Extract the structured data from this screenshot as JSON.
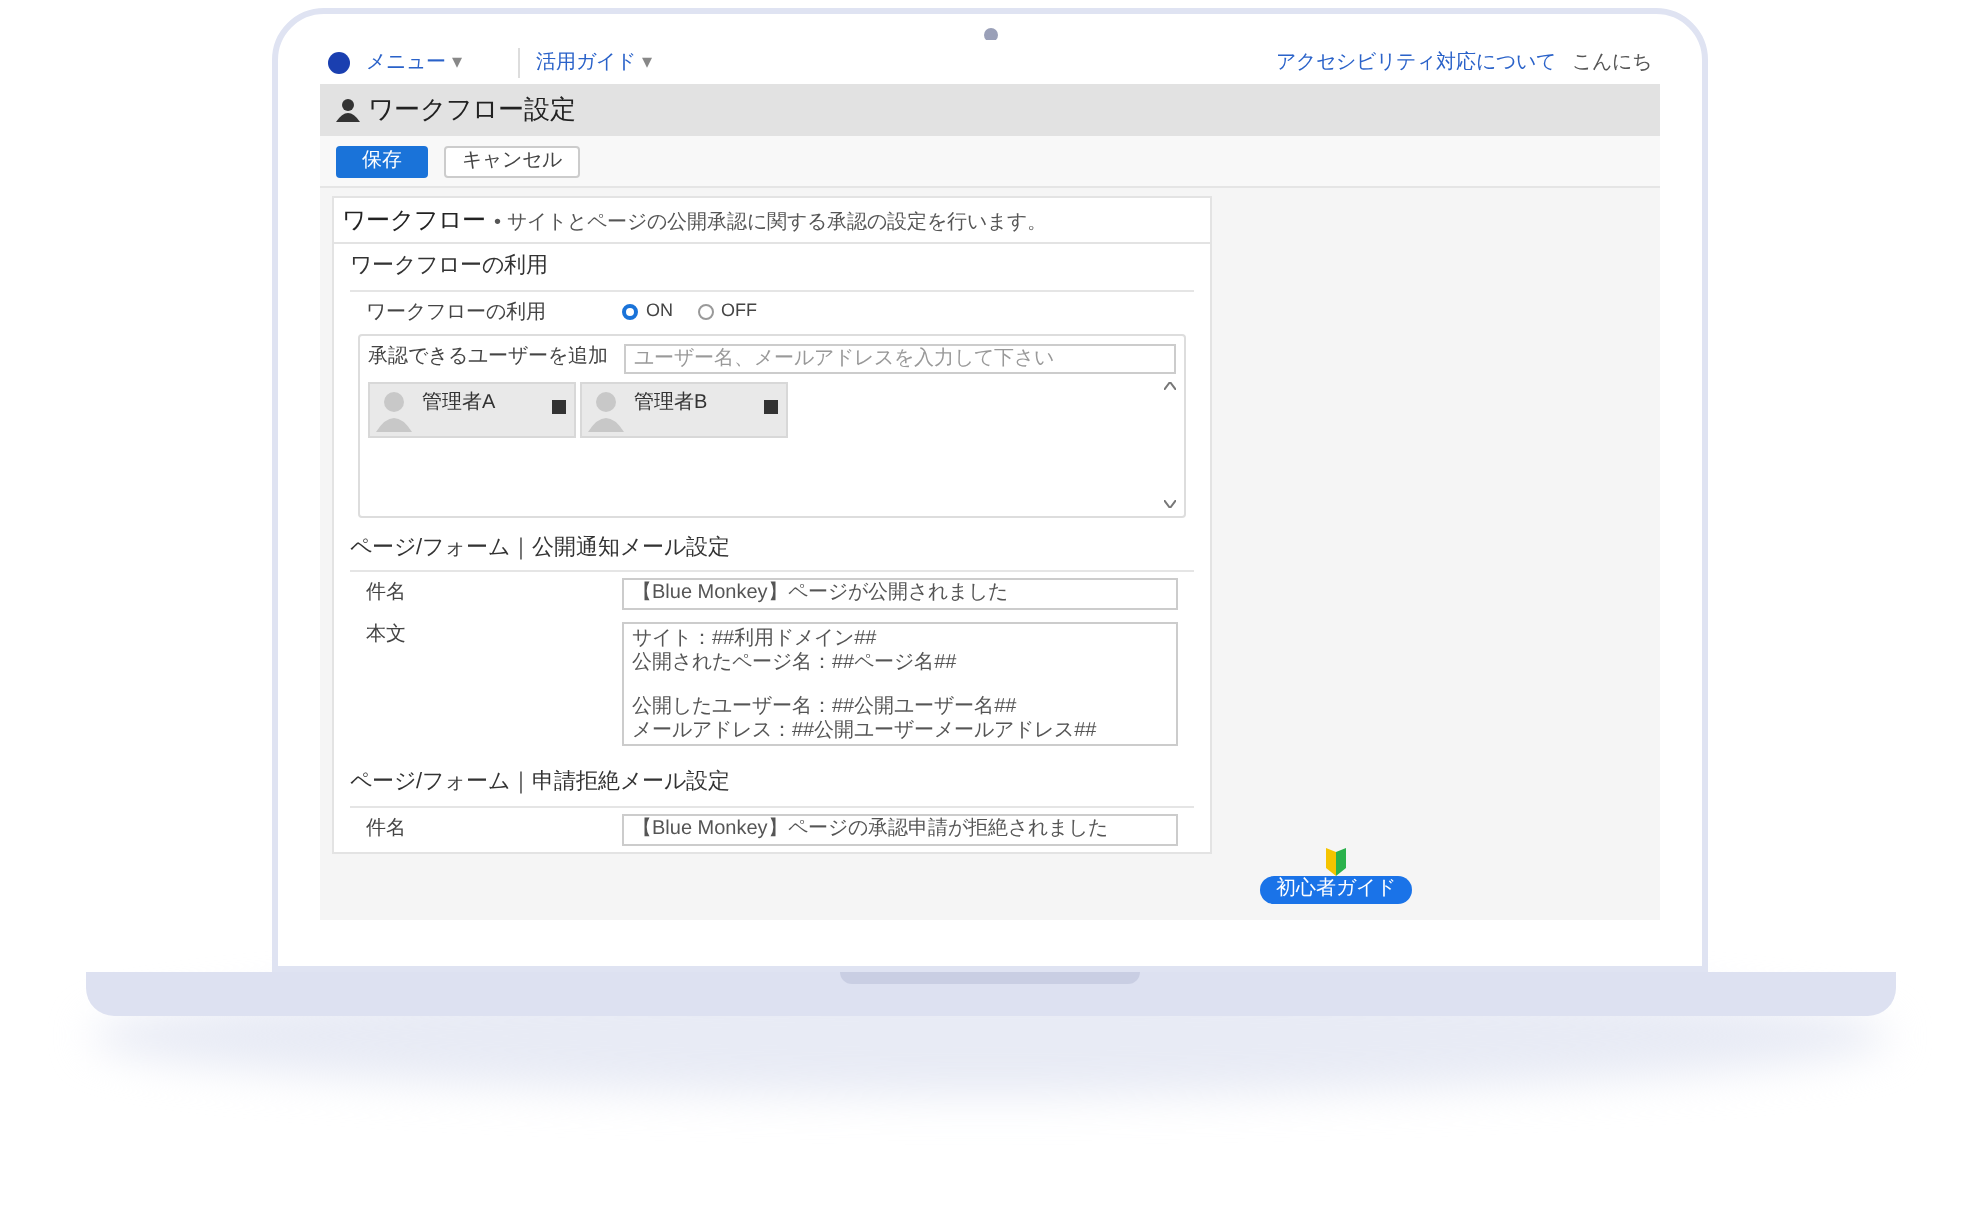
{
  "top_nav": {
    "menu": "メニュー",
    "menu_caret": "▾",
    "guide": "活用ガイド",
    "guide_caret": "▾",
    "accessibility": "アクセシビリティ対応について",
    "greeting": "こんにち"
  },
  "page_title": "ワークフロー設定",
  "actions": [
    {
      "label": "保存",
      "kind": "primary"
    },
    {
      "label": "キャンセル",
      "kind": "secondary"
    }
  ],
  "panel": {
    "title": "ワークフロー",
    "separator": "•",
    "description": "サイトとページの公開承認に関する承認の設定を行います。"
  },
  "workflow_section": {
    "title": "ワークフローの利用",
    "label": "ワークフローの利用",
    "options": [
      {
        "label": "ON",
        "selected": true
      },
      {
        "label": "OFF",
        "selected": false
      }
    ],
    "approvers": {
      "label": "承認できるユーザーを追加",
      "placeholder": "ユーザー名、メールアドレスを入力して下さい",
      "users": [
        {
          "name": "管理者A"
        },
        {
          "name": "管理者B"
        }
      ]
    }
  },
  "mail_sections": [
    {
      "title": "ページ/フォーム｜公開通知メール設定",
      "fields": [
        {
          "label": "件名",
          "kind": "input",
          "value": "【Blue Monkey】ページが公開されました"
        },
        {
          "label": "本文",
          "kind": "textarea",
          "paragraphs": [
            [
              "サイト：##利用ドメイン##",
              "公開されたページ名：##ページ名##"
            ],
            [
              "公開したユーザー名：##公開ユーザー名##",
              "メールアドレス：##公開ユーザーメールアドレス##"
            ]
          ]
        }
      ]
    },
    {
      "title": "ページ/フォーム｜申請拒絶メール設定",
      "fields": [
        {
          "label": "件名",
          "kind": "input",
          "value": "【Blue Monkey】ページの承認申請が拒絶されました"
        }
      ]
    }
  ],
  "guide_badge": "初心者ガイド"
}
